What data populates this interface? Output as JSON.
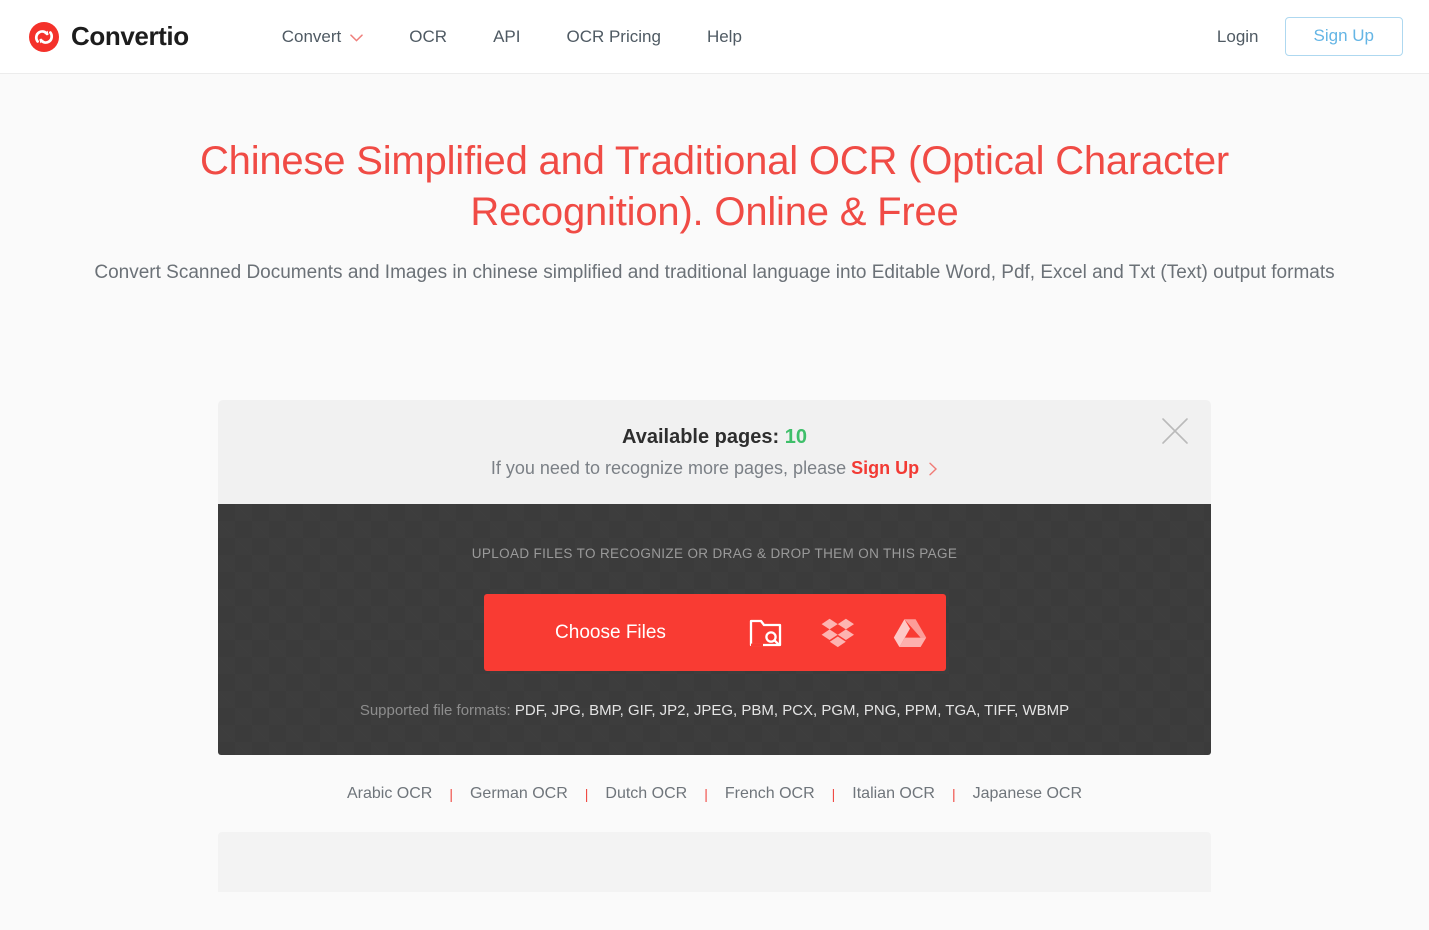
{
  "header": {
    "brand": {
      "name": "Convertio",
      "logo_icon": "convertio-logo-icon",
      "accent": "#f4312a"
    },
    "nav": [
      {
        "label": "Convert",
        "has_dropdown": true,
        "icon": "chevron-down-icon"
      },
      {
        "label": "OCR",
        "has_dropdown": false
      },
      {
        "label": "API",
        "has_dropdown": false
      },
      {
        "label": "OCR Pricing",
        "has_dropdown": false
      },
      {
        "label": "Help",
        "has_dropdown": false
      }
    ],
    "login_label": "Login",
    "signup_label": "Sign Up"
  },
  "hero": {
    "title_line1": "Chinese Simplified and Traditional OCR (Optical Character Recognition).",
    "title_line2": "Online & Free",
    "subtitle": "Convert Scanned Documents and Images in chinese simplified and traditional language into Editable Word, Pdf, Excel and Txt (Text) output formats",
    "title_color": "#f04b45"
  },
  "banner": {
    "pages_label": "Available pages:",
    "pages_count": "10",
    "pages_count_color": "#3fbf6a",
    "prompt_prefix": "If you need to recognize more pages, please",
    "prompt_link": "Sign Up",
    "prompt_link_color": "#f23a34",
    "close_icon": "close-icon",
    "arrow_icon": "chevron-right-icon"
  },
  "dropzone": {
    "hint": "UPLOAD FILES TO RECOGNIZE OR DRAG & DROP THEM ON THIS PAGE",
    "choose_files_label": "Choose Files",
    "button_color": "#f93b33",
    "sources": [
      {
        "name": "from-computer-icon",
        "title": "From Computer"
      },
      {
        "name": "dropbox-icon",
        "title": "From Dropbox"
      },
      {
        "name": "google-drive-icon",
        "title": "From Google Drive"
      }
    ],
    "formats_label": "Supported file formats:",
    "formats_list": "PDF, JPG, BMP, GIF, JP2, JPEG, PBM, PCX, PGM, PNG, PPM, TGA, TIFF, WBMP"
  },
  "language_links": [
    {
      "label": "Arabic OCR"
    },
    {
      "label": "German OCR"
    },
    {
      "label": "Dutch OCR"
    },
    {
      "label": "French OCR"
    },
    {
      "label": "Italian OCR"
    },
    {
      "label": "Japanese OCR"
    }
  ],
  "language_separator": "|"
}
